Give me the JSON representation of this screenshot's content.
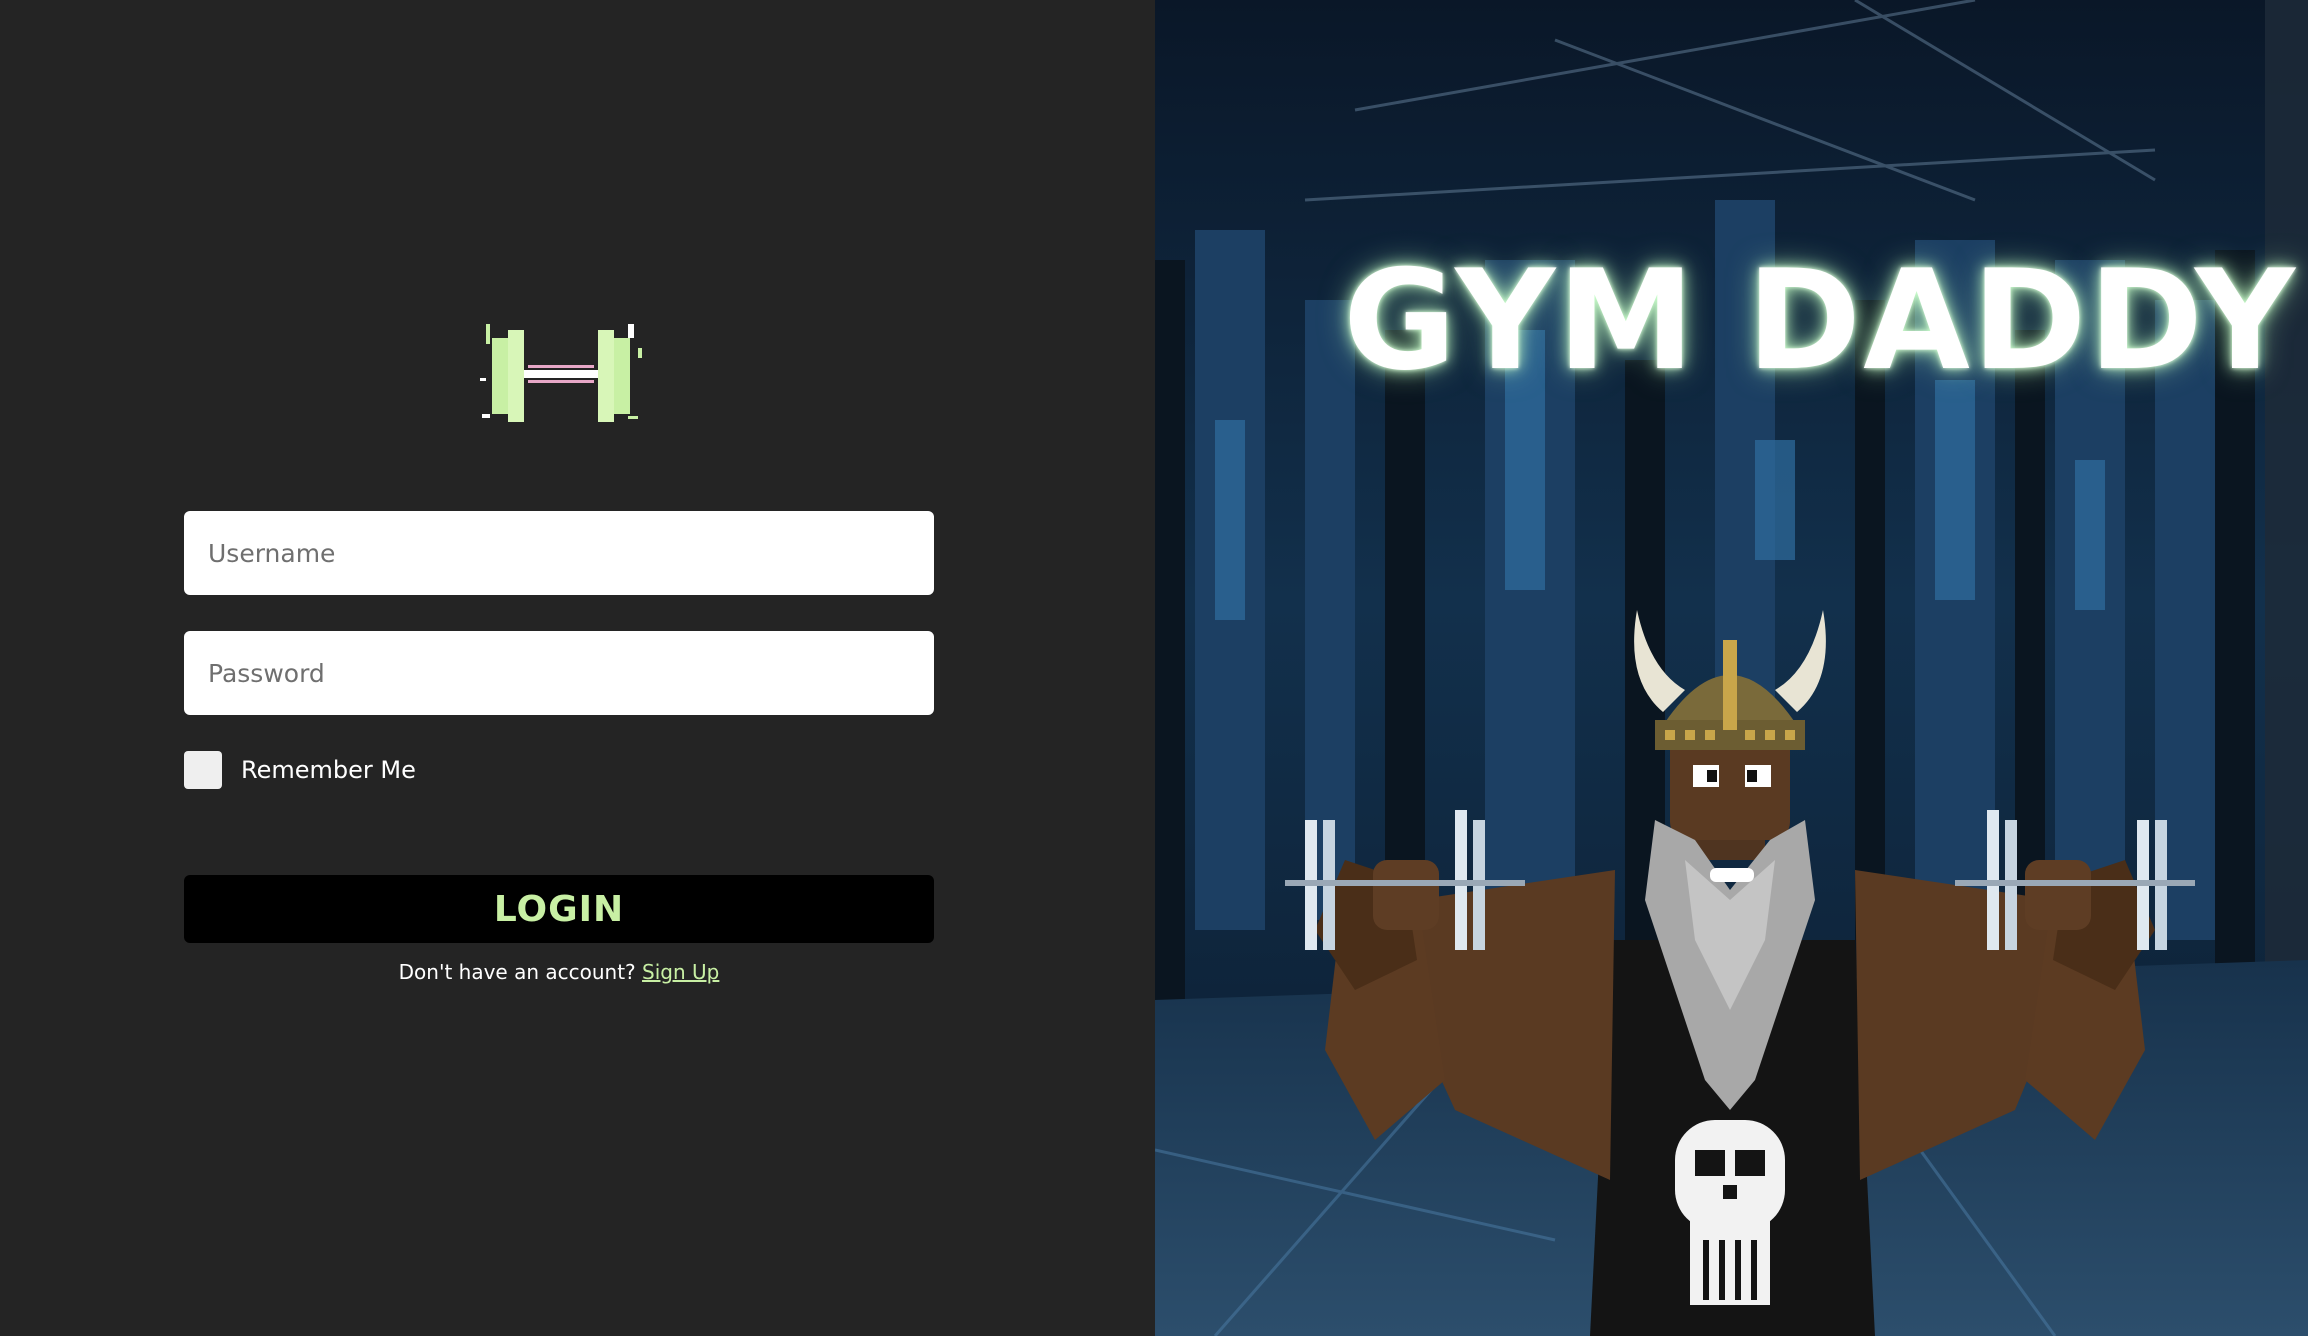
{
  "brand": {
    "logo_icon": "dumbbell-icon",
    "accent_color": "#c8f0a4"
  },
  "form": {
    "username_placeholder": "Username",
    "password_placeholder": "Password",
    "remember_label": "Remember Me",
    "login_label": "LOGIN",
    "signup_prompt": "Don't have an account?",
    "signup_link": "Sign Up"
  },
  "hero": {
    "title": "GYM DADDY",
    "illustration": "viking-bodybuilder-illustration",
    "background_color": "#0d1c2e"
  },
  "colors": {
    "page_bg": "#242424",
    "button_bg": "#000000",
    "input_bg": "#ffffff"
  }
}
